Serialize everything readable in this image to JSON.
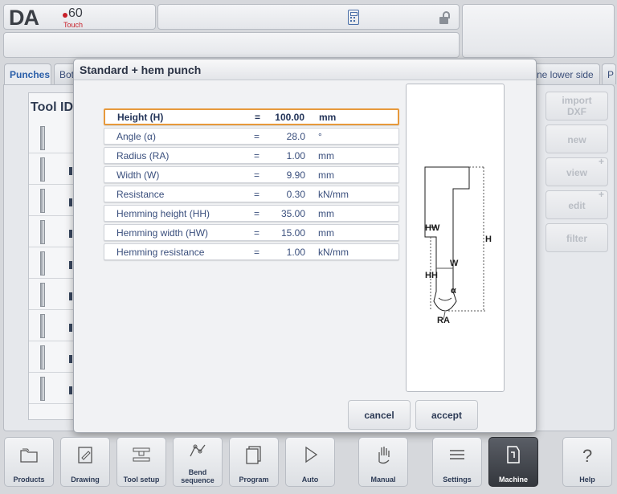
{
  "header": {
    "logo_text": "DA",
    "logo_model": "60",
    "logo_sub": "Touch"
  },
  "tabs": [
    {
      "label": "Punches"
    },
    {
      "label": "Bot"
    },
    {
      "label": "ne lower side"
    },
    {
      "label": "P"
    }
  ],
  "list": {
    "header": "Tool ID"
  },
  "side_buttons": {
    "import_line1": "import",
    "import_line2": "DXF",
    "new": "new",
    "view": "view",
    "edit": "edit",
    "filter": "filter"
  },
  "dialog": {
    "title": "Standard + hem punch",
    "rows": [
      {
        "label": "Height (H)",
        "eq": "=",
        "value": "100.00",
        "unit": "mm"
      },
      {
        "label": "Angle (α)",
        "eq": "=",
        "value": "28.0",
        "unit": "°"
      },
      {
        "label": "Radius (RA)",
        "eq": "=",
        "value": "1.00",
        "unit": "mm"
      },
      {
        "label": "Width (W)",
        "eq": "=",
        "value": "9.90",
        "unit": "mm"
      },
      {
        "label": "Resistance",
        "eq": "=",
        "value": "0.30",
        "unit": "kN/mm"
      },
      {
        "label": "Hemming height (HH)",
        "eq": "=",
        "value": "35.00",
        "unit": "mm"
      },
      {
        "label": "Hemming width (HW)",
        "eq": "=",
        "value": "15.00",
        "unit": "mm"
      },
      {
        "label": "Hemming resistance",
        "eq": "=",
        "value": "1.00",
        "unit": "kN/mm"
      }
    ],
    "drawing_labels": {
      "hw": "HW",
      "h": "H",
      "w": "W",
      "hh": "HH",
      "alpha": "α",
      "ra": "RA"
    },
    "cancel_label": "cancel",
    "accept_label": "accept"
  },
  "nav": [
    {
      "label": "Products",
      "icon": "products-icon"
    },
    {
      "label": "Drawing",
      "icon": "drawing-icon"
    },
    {
      "label": "Tool setup",
      "icon": "tool-setup-icon"
    },
    {
      "label": "Bend sequence",
      "icon": "bend-sequence-icon"
    },
    {
      "label": "Program",
      "icon": "program-icon"
    },
    {
      "label": "Auto",
      "icon": "auto-icon"
    },
    {
      "label": "Manual",
      "icon": "manual-icon"
    },
    {
      "label": "Settings",
      "icon": "settings-icon"
    },
    {
      "label": "Machine",
      "icon": "machine-icon"
    },
    {
      "label": "Help",
      "icon": "help-icon"
    }
  ],
  "colors": {
    "accent": "#2a5ea8",
    "selection_border": "#e7993b",
    "logo_red": "#c8202a"
  }
}
